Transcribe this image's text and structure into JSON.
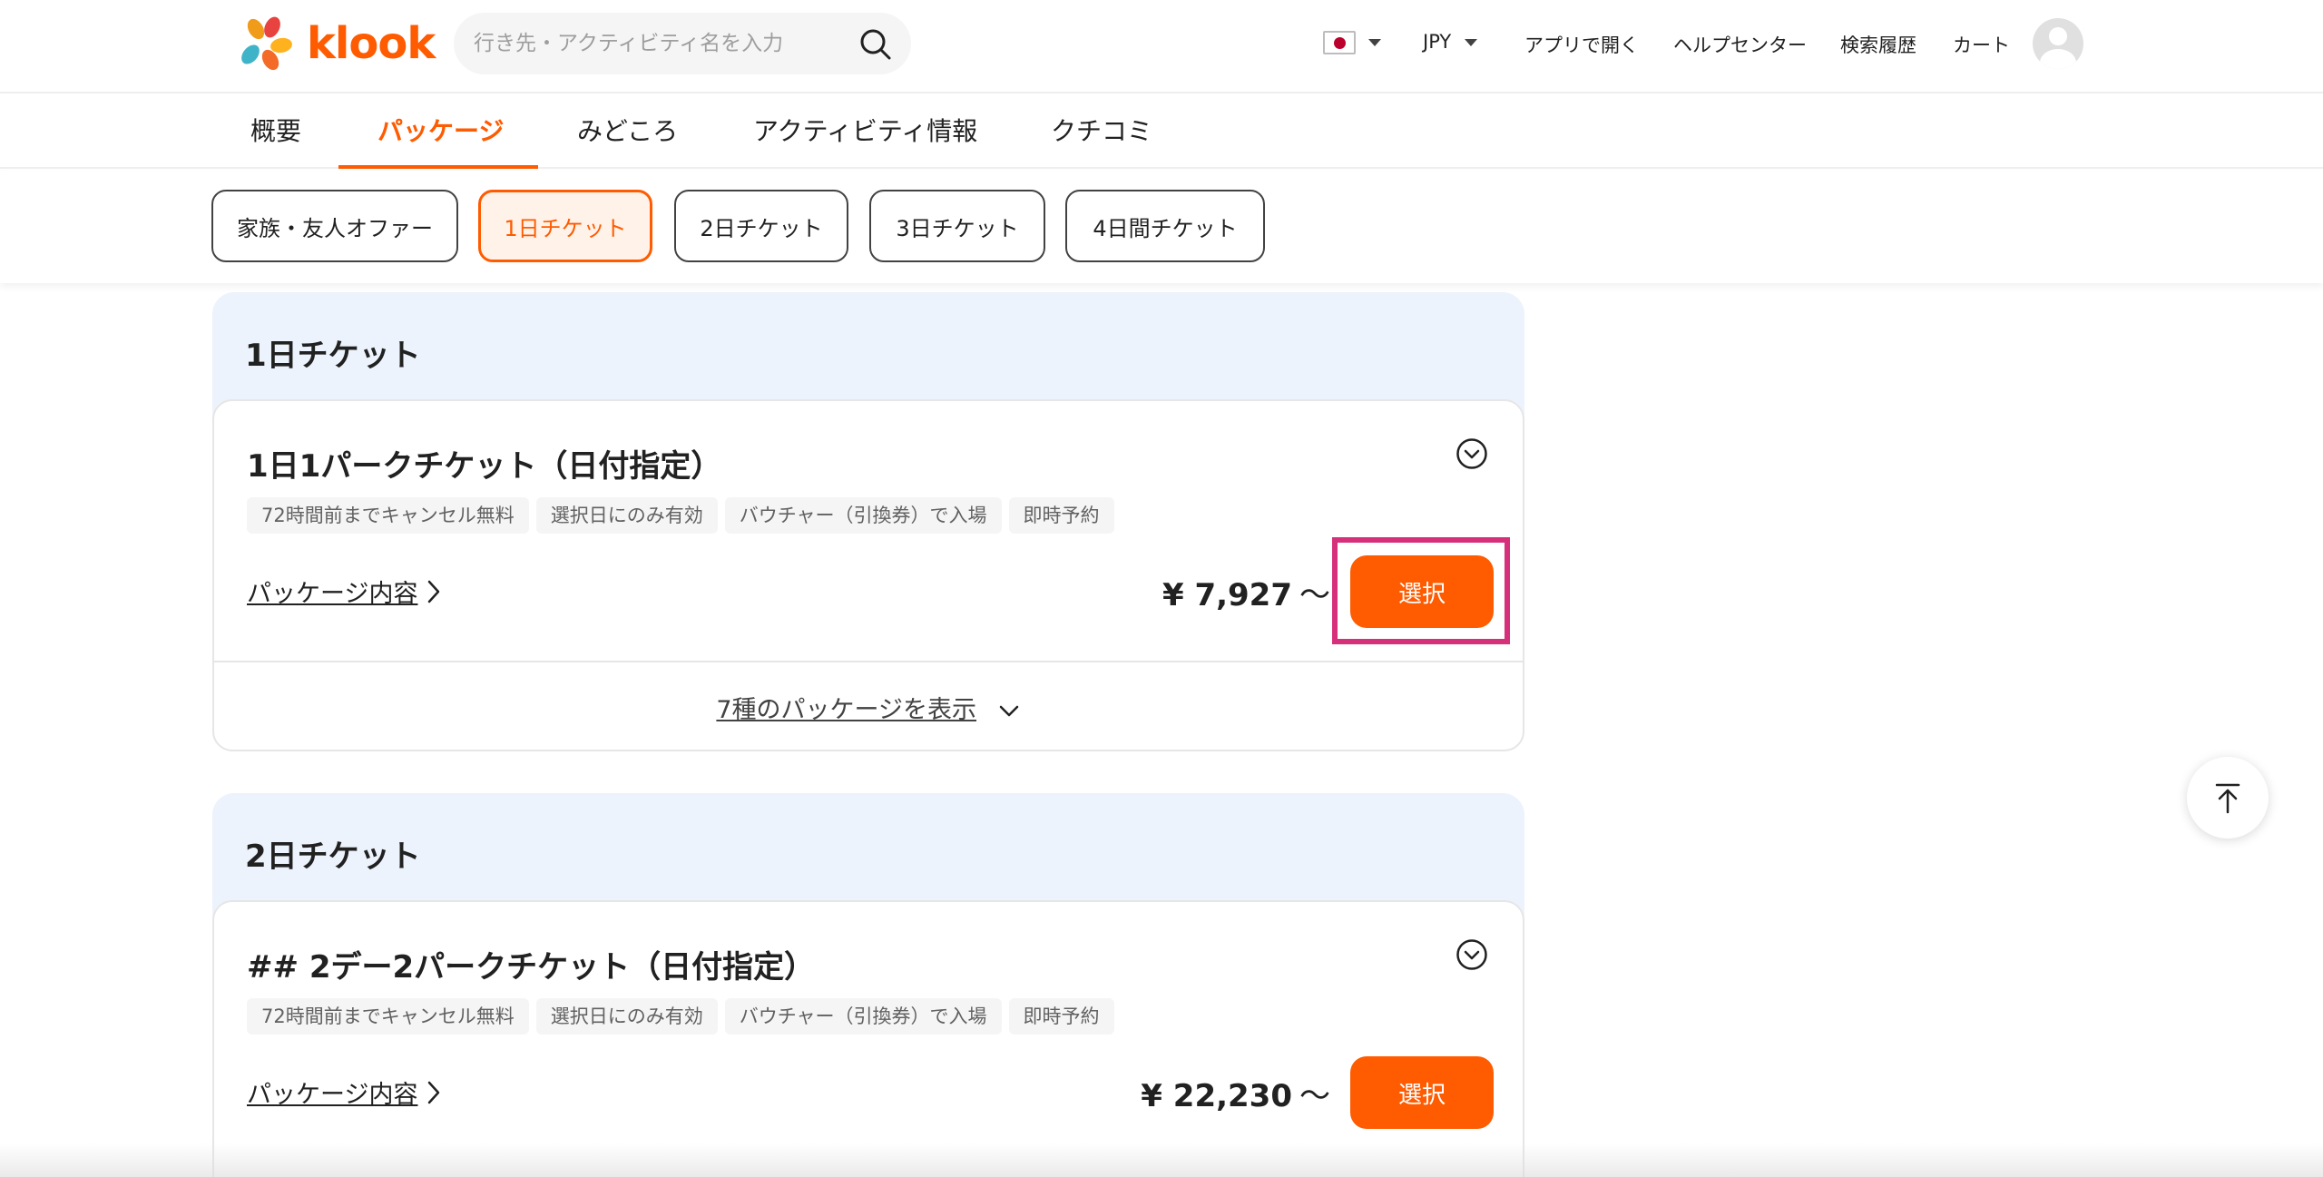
{
  "header": {
    "logo_text": "klook",
    "search_placeholder": "行き先・アクティビティ名を入力",
    "currency": "JPY",
    "links": [
      "アプリで開く",
      "ヘルプセンター",
      "検索履歴",
      "カート"
    ]
  },
  "tabs": [
    {
      "label": "概要",
      "active": false
    },
    {
      "label": "パッケージ",
      "active": true
    },
    {
      "label": "みどころ",
      "active": false
    },
    {
      "label": "アクティビティ情報",
      "active": false
    },
    {
      "label": "クチコミ",
      "active": false
    }
  ],
  "filters": [
    {
      "label": "家族・友人オファー",
      "active": false
    },
    {
      "label": "1日チケット",
      "active": true
    },
    {
      "label": "2日チケット",
      "active": false
    },
    {
      "label": "3日チケット",
      "active": false
    },
    {
      "label": "4日間チケット",
      "active": false
    }
  ],
  "sections": [
    {
      "title": "1日チケット",
      "card": {
        "title": "1日1パークチケット（日付指定）",
        "tags": [
          "72時間前までキャンセル無料",
          "選択日にのみ有効",
          "バウチャー（引換券）で入場",
          "即時予約"
        ],
        "link": "パッケージ内容",
        "price": "¥ 7,927",
        "price_suffix": "〜",
        "button": "選択",
        "more": "7種のパッケージを表示"
      }
    },
    {
      "title": "2日チケット",
      "card": {
        "title": "## 2デー2パークチケット（日付指定）",
        "tags": [
          "72時間前までキャンセル無料",
          "選択日にのみ有効",
          "バウチャー（引換券）で入場",
          "即時予約"
        ],
        "link": "パッケージ内容",
        "price": "¥ 22,230",
        "price_suffix": "〜",
        "button": "選択"
      }
    }
  ],
  "colors": {
    "accent": "#ff5b00",
    "highlight": "#d6307a",
    "section_bg": "#edf3fc"
  }
}
